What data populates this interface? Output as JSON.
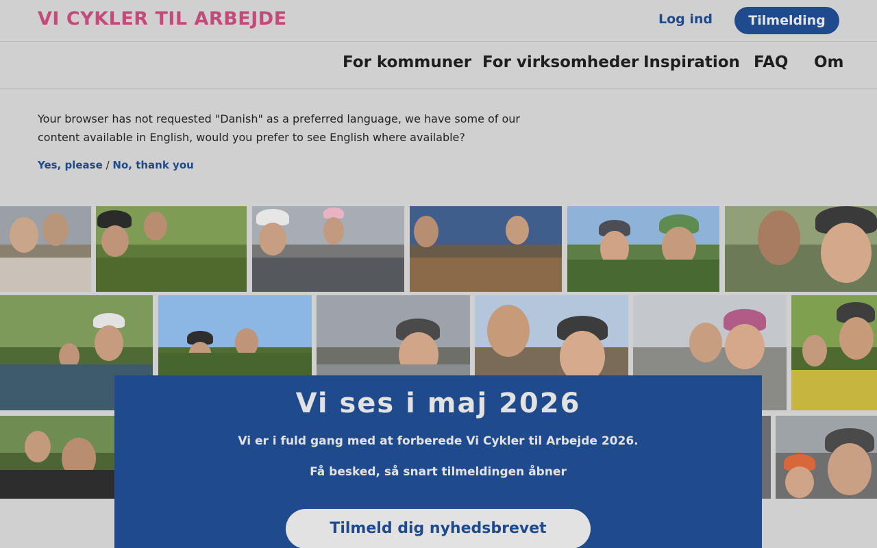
{
  "header": {
    "logo": "VI CYKLER TIL ARBEJDE",
    "login_label": "Log ind",
    "signup_label": "Tilmelding"
  },
  "nav": {
    "items": [
      "For kommuner",
      "For virksomheder",
      "Inspiration",
      "FAQ",
      "Om"
    ]
  },
  "language_notice": {
    "text": "Your browser has not requested \"Danish\" as a preferred language, we have some of our content available in English, would you prefer to see English where available?",
    "yes_label": "Yes, please",
    "separator": "/",
    "no_label": "No, thank you"
  },
  "promo": {
    "title": "Vi ses i maj 2026",
    "line1": "Vi er i fuld gang med at forberede Vi Cykler til Arbejde 2026.",
    "line2": "Få besked, så snart tilmeldingen åbner",
    "button_label": "Tilmeld dig nyhedsbrevet"
  },
  "colors": {
    "brand_pink": "#c44a7a",
    "brand_blue": "#1f4a8c",
    "background": "#d0d0d0"
  }
}
